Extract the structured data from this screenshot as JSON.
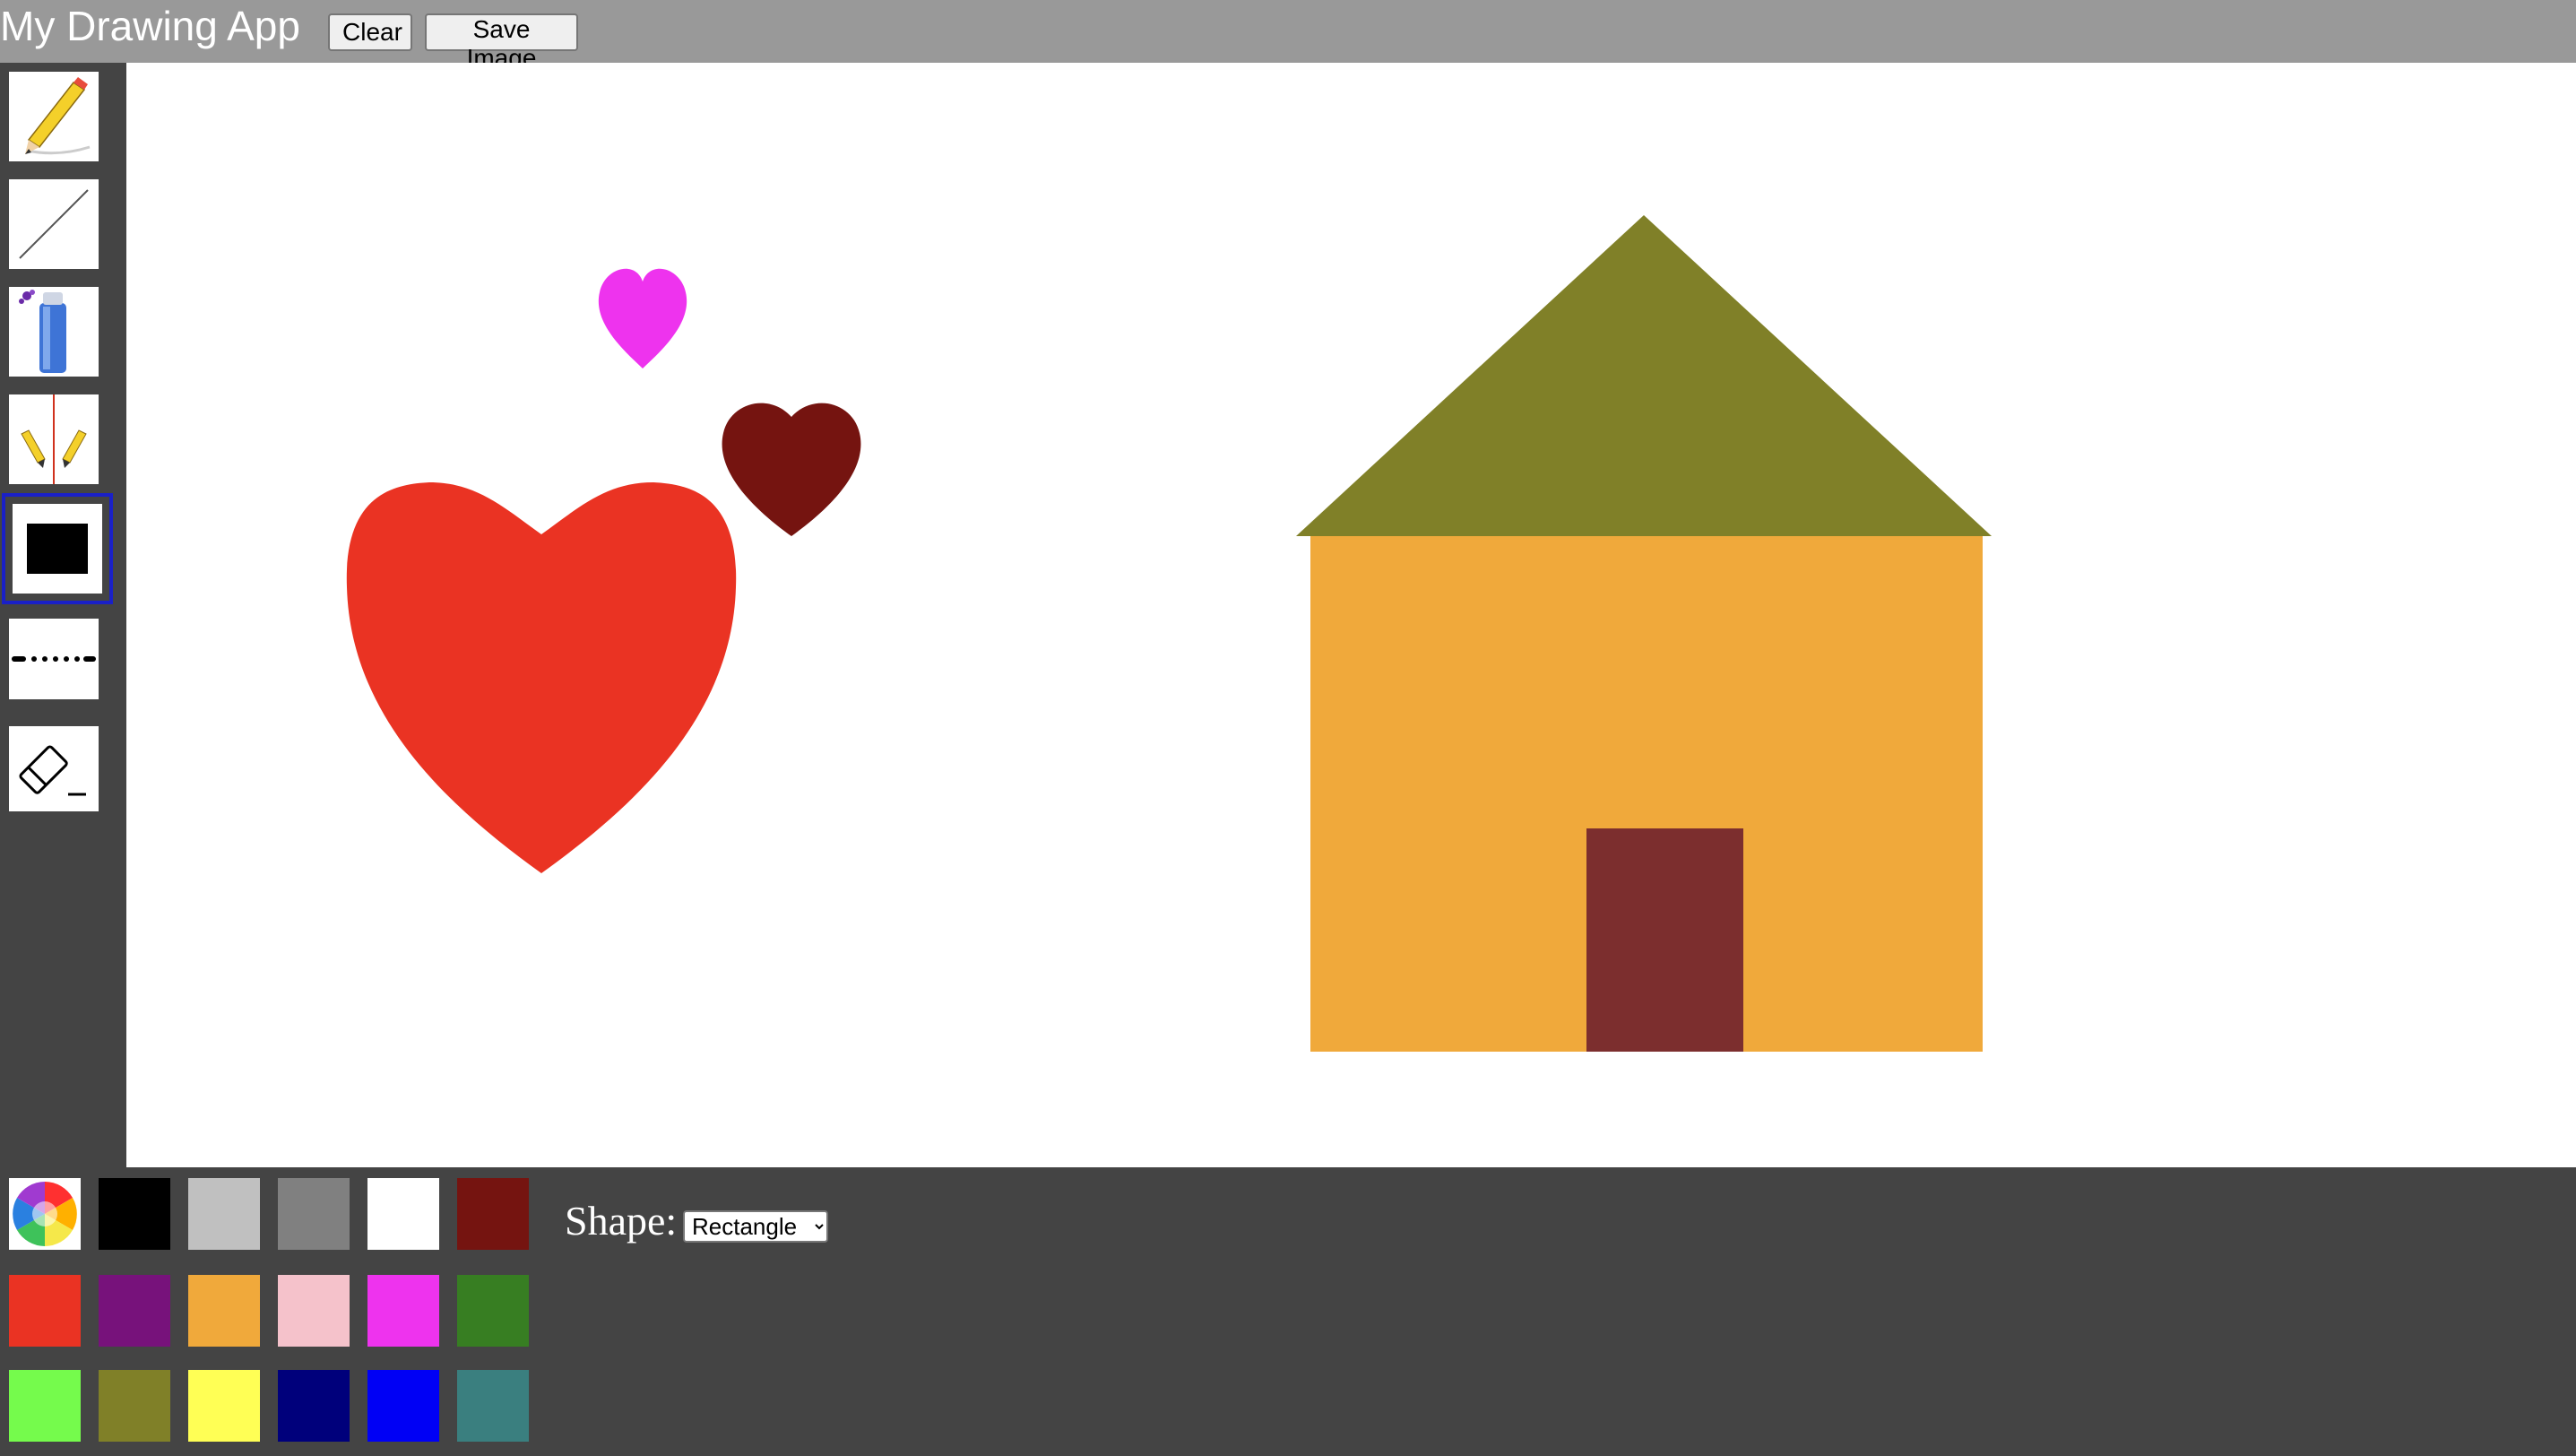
{
  "app": {
    "title": "My Drawing App",
    "clear_label": "Clear",
    "save_label": "Save Image"
  },
  "tools": [
    {
      "name": "pencil",
      "icon": "pencil-icon"
    },
    {
      "name": "line",
      "icon": "line-icon"
    },
    {
      "name": "spray",
      "icon": "spray-can-icon"
    },
    {
      "name": "mirror",
      "icon": "mirror-pencil-icon"
    },
    {
      "name": "shape",
      "icon": "rectangle-icon",
      "selected": true
    },
    {
      "name": "dashed-line",
      "icon": "dashed-line-icon"
    },
    {
      "name": "eraser",
      "icon": "eraser-icon"
    }
  ],
  "canvas": {
    "shapes": [
      {
        "kind": "heart",
        "fill": "#ee33ee"
      },
      {
        "kind": "heart",
        "fill": "#751410"
      },
      {
        "kind": "heart",
        "fill": "#ea3323"
      },
      {
        "kind": "triangle",
        "fill": "#808028"
      },
      {
        "kind": "rectangle",
        "fill": "#f0a93b"
      },
      {
        "kind": "rectangle",
        "fill": "#7c2e2e"
      }
    ]
  },
  "palette": {
    "colors": [
      "#000000",
      "#c0c0c0",
      "#808080",
      "#ffffff",
      "#751410",
      "#ea3323",
      "#77127b",
      "#f0a93b",
      "#f5c2cb",
      "#ee33ee",
      "#377e22",
      "#75fb4c",
      "#808028",
      "#ffff55",
      "#00007b",
      "#0000f5",
      "#3a7f7f"
    ]
  },
  "shape_control": {
    "label": "Shape:",
    "selected": "Rectangle"
  }
}
